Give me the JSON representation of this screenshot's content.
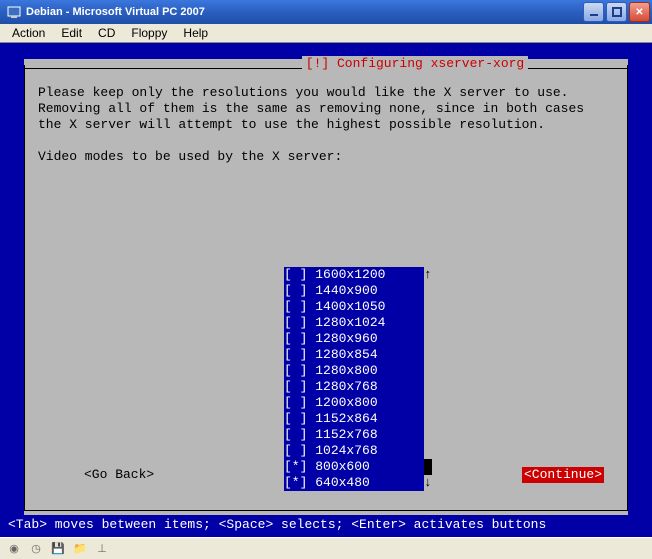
{
  "window": {
    "title": "Debian - Microsoft Virtual PC 2007",
    "menu": [
      "Action",
      "Edit",
      "CD",
      "Floppy",
      "Help"
    ]
  },
  "dialog": {
    "title": "[!] Configuring xserver-xorg",
    "paragraph": "Please keep only the resolutions you would like the X server to use. Removing all of them is the same as removing none, since in both cases the X server will attempt to use the highest possible resolution.",
    "prompt": "Video modes to be used by the X server:",
    "items": [
      {
        "mark": " ",
        "label": "1600x1200"
      },
      {
        "mark": " ",
        "label": "1440x900"
      },
      {
        "mark": " ",
        "label": "1400x1050"
      },
      {
        "mark": " ",
        "label": "1280x1024"
      },
      {
        "mark": " ",
        "label": "1280x960"
      },
      {
        "mark": " ",
        "label": "1280x854"
      },
      {
        "mark": " ",
        "label": "1280x800"
      },
      {
        "mark": " ",
        "label": "1280x768"
      },
      {
        "mark": " ",
        "label": "1200x800"
      },
      {
        "mark": " ",
        "label": "1152x864"
      },
      {
        "mark": " ",
        "label": "1152x768"
      },
      {
        "mark": " ",
        "label": "1024x768"
      },
      {
        "mark": "*",
        "label": "800x600"
      },
      {
        "mark": "*",
        "label": "640x480"
      }
    ],
    "go_back": "<Go Back>",
    "continue": "<Continue>"
  },
  "helpline": "<Tab> moves between items; <Space> selects; <Enter> activates buttons",
  "status_icons": [
    "disc-icon",
    "clock-icon",
    "save-icon",
    "folder-icon",
    "net-icon"
  ]
}
